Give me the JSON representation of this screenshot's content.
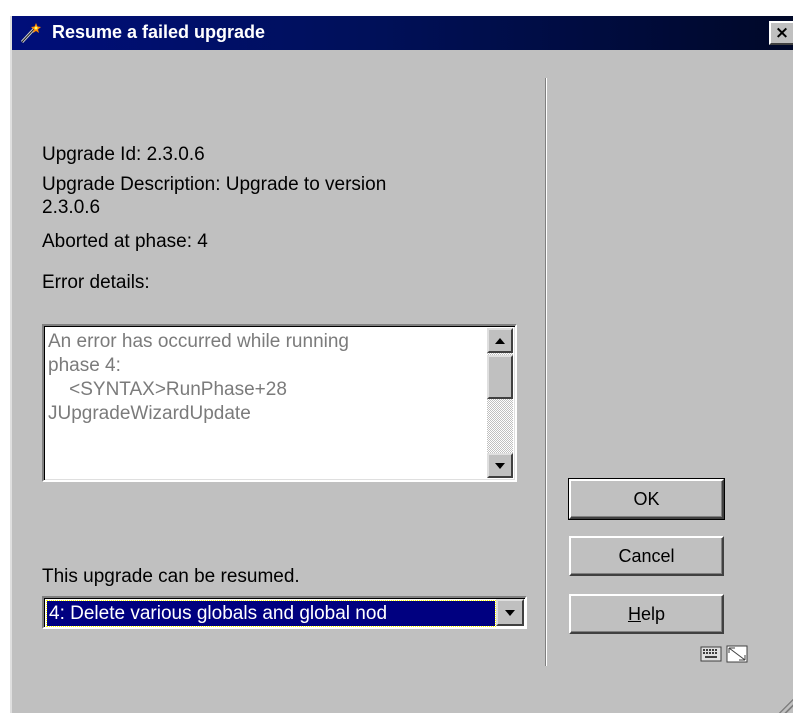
{
  "window": {
    "title": "Resume a failed upgrade",
    "close_label": "×"
  },
  "info": {
    "upgrade_id": "Upgrade Id: 2.3.0.6",
    "description_line1": "Upgrade Description: Upgrade to version",
    "description_line2": "2.3.0.6",
    "aborted_phase": "Aborted at phase: 4",
    "error_details_label": "Error details:"
  },
  "error_box": {
    "text": "An error has occurred while running\nphase 4:\n    <SYNTAX>RunPhase+28\nJUpgradeWizardUpdate"
  },
  "resume": {
    "status_text": "This upgrade can be resumed.",
    "selected_phase": "4: Delete various globals and global nod"
  },
  "buttons": {
    "ok": "OK",
    "cancel": "Cancel",
    "help_mnemonic": "H",
    "help_rest": "elp"
  },
  "colors": {
    "titlebar": "#000e7a",
    "dialog_bg": "#c0c0c0",
    "selection": "#000080",
    "error_text": "#7b7b7b"
  },
  "icons": [
    "wand-icon",
    "close-icon",
    "keyboard-icon",
    "window-icon",
    "resize-grip-icon"
  ]
}
